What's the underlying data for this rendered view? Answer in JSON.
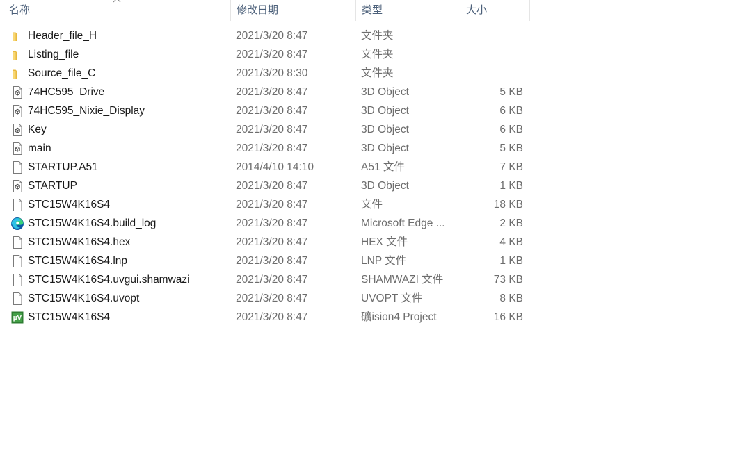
{
  "columns": {
    "name": "名称",
    "date": "修改日期",
    "type": "类型",
    "size": "大小"
  },
  "files": [
    {
      "name": "Header_file_H",
      "date": "2021/3/20 8:47",
      "type": "文件夹",
      "size": "",
      "icon": "folder-icon"
    },
    {
      "name": "Listing_file",
      "date": "2021/3/20 8:47",
      "type": "文件夹",
      "size": "",
      "icon": "folder-icon"
    },
    {
      "name": "Source_file_C",
      "date": "2021/3/20 8:30",
      "type": "文件夹",
      "size": "",
      "icon": "folder-icon"
    },
    {
      "name": "74HC595_Drive",
      "date": "2021/3/20 8:47",
      "type": "3D Object",
      "size": "5 KB",
      "icon": "3d-object-icon"
    },
    {
      "name": "74HC595_Nixie_Display",
      "date": "2021/3/20 8:47",
      "type": "3D Object",
      "size": "6 KB",
      "icon": "3d-object-icon"
    },
    {
      "name": "Key",
      "date": "2021/3/20 8:47",
      "type": "3D Object",
      "size": "6 KB",
      "icon": "3d-object-icon"
    },
    {
      "name": "main",
      "date": "2021/3/20 8:47",
      "type": "3D Object",
      "size": "5 KB",
      "icon": "3d-object-icon"
    },
    {
      "name": "STARTUP.A51",
      "date": "2014/4/10 14:10",
      "type": "A51 文件",
      "size": "7 KB",
      "icon": "blank-file-icon"
    },
    {
      "name": "STARTUP",
      "date": "2021/3/20 8:47",
      "type": "3D Object",
      "size": "1 KB",
      "icon": "3d-object-icon"
    },
    {
      "name": "STC15W4K16S4",
      "date": "2021/3/20 8:47",
      "type": "文件",
      "size": "18 KB",
      "icon": "blank-file-icon"
    },
    {
      "name": "STC15W4K16S4.build_log",
      "date": "2021/3/20 8:47",
      "type": "Microsoft Edge ...",
      "size": "2 KB",
      "icon": "edge-icon"
    },
    {
      "name": "STC15W4K16S4.hex",
      "date": "2021/3/20 8:47",
      "type": "HEX 文件",
      "size": "4 KB",
      "icon": "blank-file-icon"
    },
    {
      "name": "STC15W4K16S4.lnp",
      "date": "2021/3/20 8:47",
      "type": "LNP 文件",
      "size": "1 KB",
      "icon": "blank-file-icon"
    },
    {
      "name": "STC15W4K16S4.uvgui.shamwazi",
      "date": "2021/3/20 8:47",
      "type": "SHAMWAZI 文件",
      "size": "73 KB",
      "icon": "blank-file-icon"
    },
    {
      "name": "STC15W4K16S4.uvopt",
      "date": "2021/3/20 8:47",
      "type": "UVOPT 文件",
      "size": "8 KB",
      "icon": "blank-file-icon"
    },
    {
      "name": "STC15W4K16S4",
      "date": "2021/3/20 8:47",
      "type": "礦ision4 Project",
      "size": "16 KB",
      "icon": "keil-uvision-icon"
    }
  ],
  "colors": {
    "header_text": "#4c607a",
    "folder": "#f8d775",
    "edge": "#1e88e5",
    "keil": "#2e7d32"
  }
}
